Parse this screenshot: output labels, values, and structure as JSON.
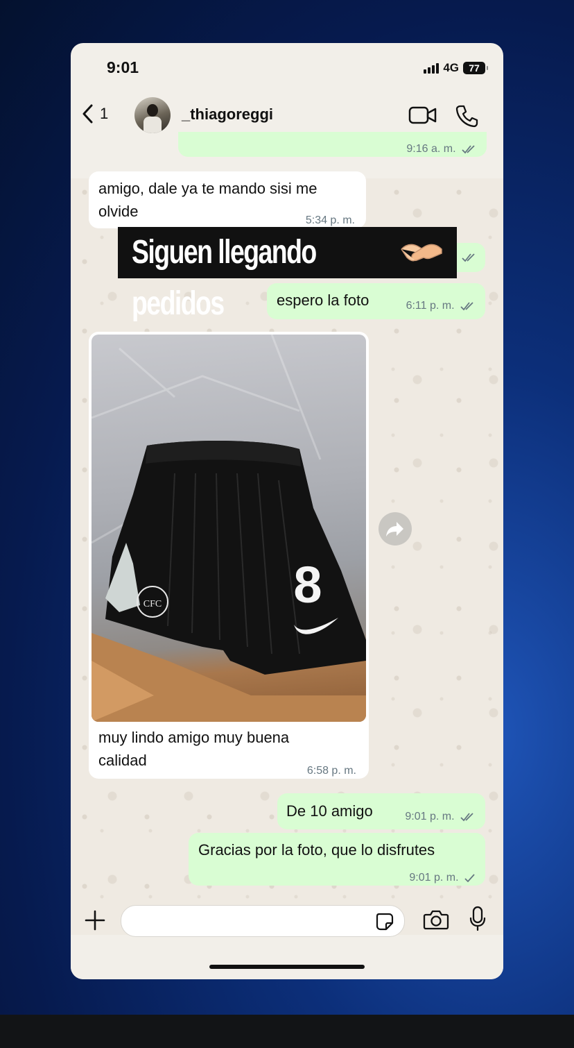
{
  "status_bar": {
    "time": "9:01",
    "network": "4G",
    "battery": "77"
  },
  "header": {
    "back_count": "1",
    "contact_name": "_thiagoreggi"
  },
  "messages": {
    "m0": {
      "time": "9:16 a. m."
    },
    "m1": {
      "text_line1": "amigo, dale ya te mando sisi me",
      "text_line2": "olvide",
      "time": "5:34 p. m."
    },
    "banner": {
      "text": "Siguen llegando pedidos"
    },
    "m2": {
      "text": "espero la foto",
      "time": "6:11 p. m."
    },
    "m3": {
      "text_line1": "muy lindo amigo muy buena",
      "text_line2": "calidad",
      "time": "6:58 p. m."
    },
    "m4": {
      "text": "De 10 amigo",
      "time": "9:01 p. m."
    },
    "m5": {
      "text": "Gracias por la foto, que lo disfrutes",
      "time": "9:01 p. m."
    }
  },
  "photo": {
    "shirt_number": "8",
    "crest_text": "CFC"
  },
  "colors": {
    "incoming": "#ffffff",
    "outgoing": "#d9fdd3",
    "wallpaper": "#efeae2",
    "tick_read": "#667781"
  },
  "icons": [
    "back-chevron-icon",
    "video-call-icon",
    "phone-call-icon",
    "forward-icon",
    "plus-icon",
    "sticker-icon",
    "camera-icon",
    "microphone-icon",
    "handshake-icon"
  ]
}
